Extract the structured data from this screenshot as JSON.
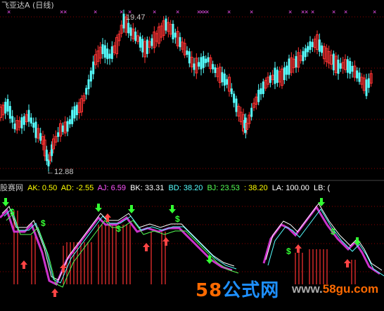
{
  "title": "飞亚达A (日线)",
  "price_labels": {
    "high": "19.47",
    "low": "12.88"
  },
  "indicator": {
    "name": "股赛网",
    "items": [
      {
        "label": "AK: 0.50",
        "color": "#ffff00"
      },
      {
        "label": "AD: -2.55",
        "color": "#ffff00"
      },
      {
        "label": "AJ: 6.59",
        "color": "#ff55ff"
      },
      {
        "label": "BK: 33.31",
        "color": "#ffffff"
      },
      {
        "label": "BD: 38.20",
        "color": "#55ffff"
      },
      {
        "label": "BJ: 23.53",
        "color": "#55ff55"
      },
      {
        "label": ": 38.20",
        "color": "#ffff00"
      },
      {
        "label": "LA: 100.00",
        "color": "#ffffff"
      },
      {
        "label": "LB: (",
        "color": "#ffffff"
      }
    ]
  },
  "watermark": {
    "brand_num": "58",
    "brand_cn": "公式网",
    "url_prefix": "www.",
    "url_main": "58gu.com"
  },
  "colors": {
    "up": "#ff3333",
    "down": "#55ffff",
    "grid": "#8b0000",
    "marker": "#ff55ff",
    "arrow_buy": "#ff4444",
    "arrow_sell": "#33ff33"
  },
  "icons": {
    "top_marker": "x-marker-icon",
    "buy": "up-arrow-icon",
    "sell": "down-arrow-icon"
  }
}
